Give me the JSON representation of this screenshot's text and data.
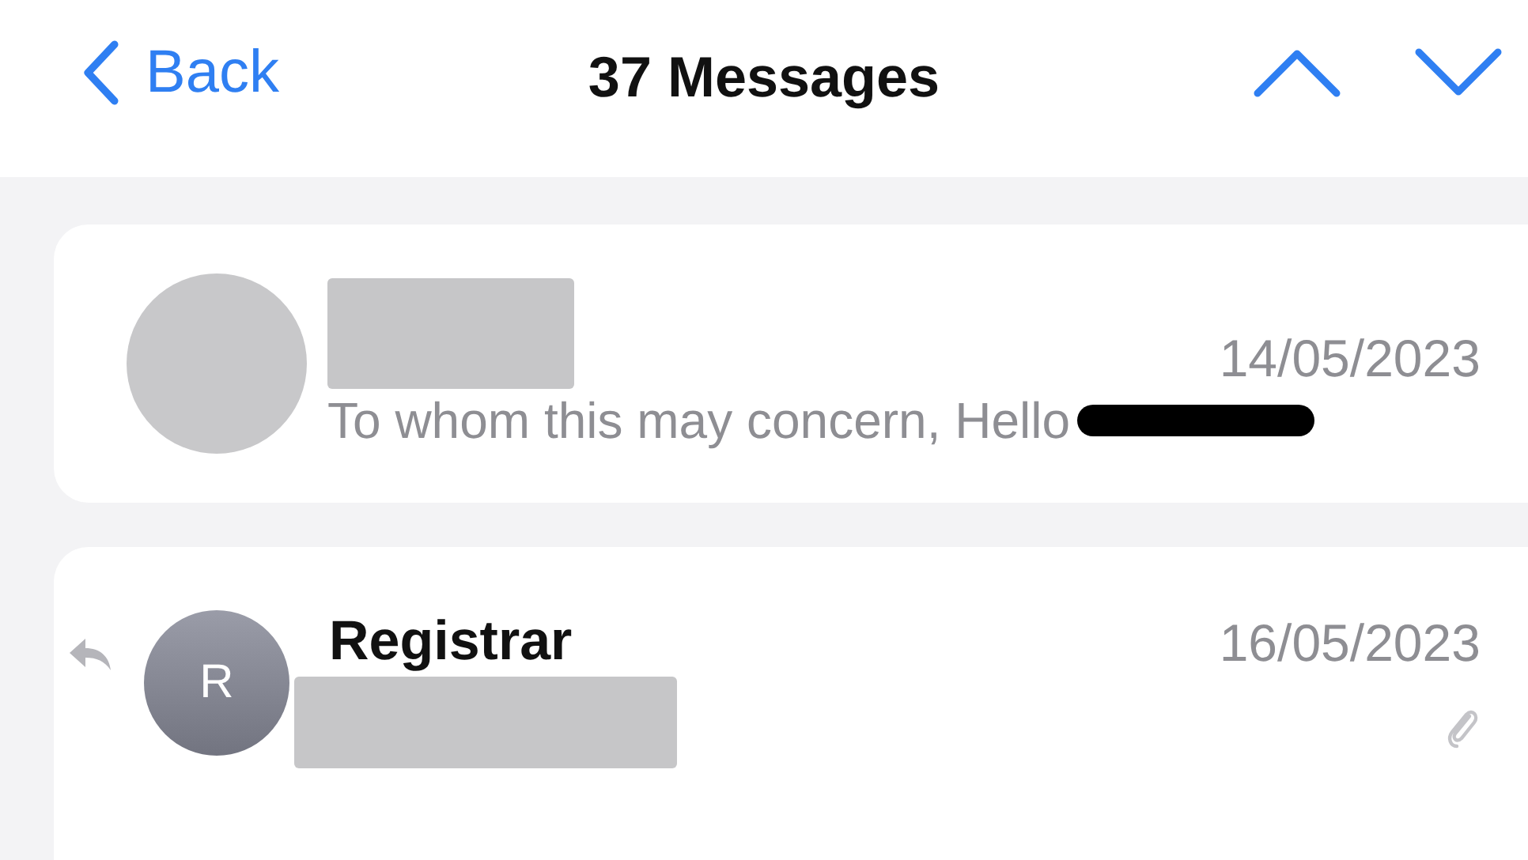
{
  "nav": {
    "back": "Back",
    "title": "37 Messages"
  },
  "messages": [
    {
      "kind": "blank",
      "sender_redacted": true,
      "date": "14/05/2023",
      "preview": "To whom this may concern, Hello",
      "preview_redacted": true,
      "replied": false,
      "attachment": false
    },
    {
      "kind": "letter",
      "avatar_letter": "R",
      "sender": "Registrar",
      "date": "16/05/2023",
      "preview_redacted": true,
      "replied": true,
      "attachment": true
    }
  ]
}
